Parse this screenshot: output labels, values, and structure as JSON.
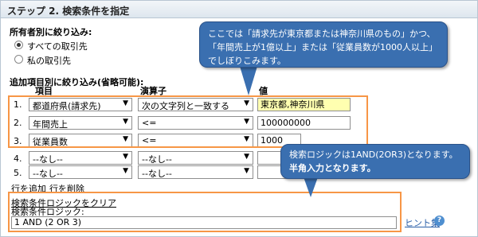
{
  "header": {
    "title": "ステップ 2. 検索条件を指定"
  },
  "owner": {
    "heading": "所有者別に絞り込み:",
    "options": [
      {
        "label": "すべての取引先",
        "checked": true
      },
      {
        "label": "私の取引先",
        "checked": false
      }
    ]
  },
  "filters": {
    "heading": "追加項目別に絞り込み(省略可能):",
    "columns": {
      "field": "項目",
      "operator": "演算子",
      "value": "値"
    },
    "rows": [
      {
        "num": "1.",
        "field": "都道府県(請求先)",
        "operator": "次の文字列と一致する",
        "value": "東京都,神奈川県",
        "highlight": true
      },
      {
        "num": "2.",
        "field": "年間売上",
        "operator": "<=",
        "value": "100000000",
        "highlight": false
      },
      {
        "num": "3.",
        "field": "従業員数",
        "operator": "<=",
        "value": "1000",
        "highlight": false
      },
      {
        "num": "4.",
        "field": "--なし--",
        "operator": "--なし--",
        "value": "",
        "highlight": false
      },
      {
        "num": "5.",
        "field": "--なし--",
        "operator": "--なし--",
        "value": "",
        "highlight": false
      }
    ],
    "add_row": "行を追加",
    "delete_row": "行を削除"
  },
  "logic": {
    "clear_link": "検索条件ロジックをクリア",
    "label": "検索条件ロジック:",
    "value": "1 AND (2 OR 3)",
    "hint_link": "ヒント集",
    "help_icon": "?"
  },
  "callouts": {
    "top": "ここでは「請求先が東京都または神奈川県のもの」かつ、「年間売上が1億以上」または「従業員数が1000人以上」でしぼりこみます。",
    "bottom_line1": "検索ロジックは1AND(2OR3)となります。",
    "bottom_line2": "半角入力となります。"
  },
  "colors": {
    "callout": "#3a6fb0",
    "highlight_border": "#f79646",
    "value_highlight": "#ffffb0"
  }
}
